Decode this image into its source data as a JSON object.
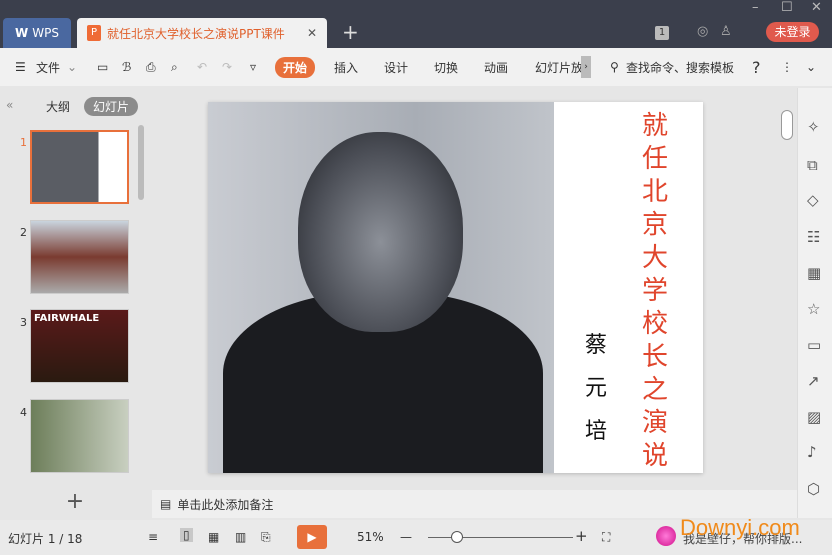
{
  "titlebar": {
    "app": "WPS",
    "doc_title": "就任北京大学校长之演说PPT课件",
    "login": "未登录",
    "badge": "1"
  },
  "toolbar": {
    "file": "文件",
    "tabs": [
      "开始",
      "插入",
      "设计",
      "切换",
      "动画",
      "幻灯片放"
    ],
    "search": "查找命令、搜索模板",
    "help": "?"
  },
  "panel": {
    "tab_outline": "大纲",
    "tab_slides": "幻灯片",
    "slides": [
      "1",
      "2",
      "3",
      "4"
    ],
    "thumb3_text": "FAIRWHALE"
  },
  "slide": {
    "title": "就任北京大学校长之演说",
    "author": "蔡元培"
  },
  "notes": {
    "placeholder": "单击此处添加备注"
  },
  "status": {
    "slide_count": "幻灯片 1 / 18",
    "zoom": "51%",
    "zoom_level": 51,
    "assistant": "我是壁仔，帮你排版...",
    "watermark": "Downyi.com"
  },
  "colors": {
    "accent": "#e8703b",
    "title_red": "#e0452c",
    "titlebar": "#3b3f4c"
  }
}
